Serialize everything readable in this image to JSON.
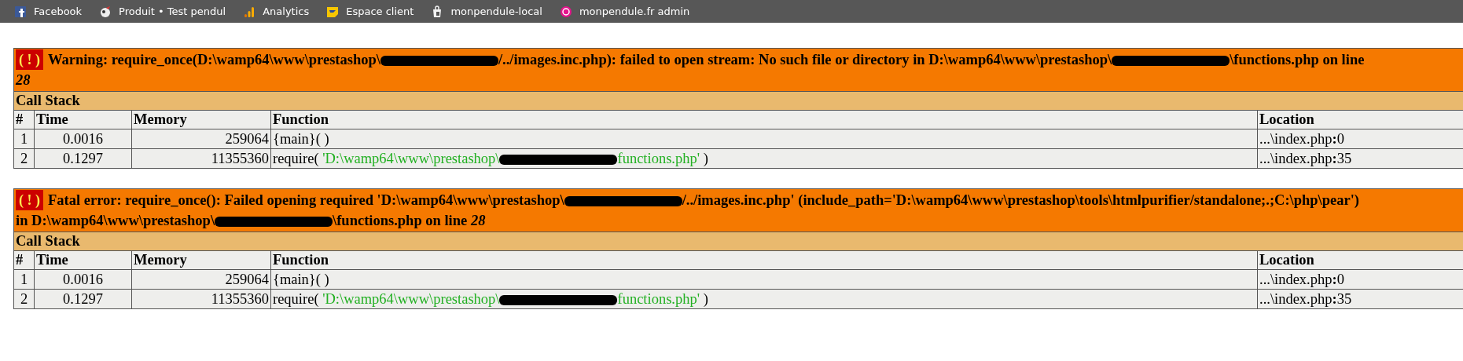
{
  "bookmarks": [
    {
      "label": "Facebook"
    },
    {
      "label": "Produit • Test pendul"
    },
    {
      "label": "Analytics"
    },
    {
      "label": "Espace client"
    },
    {
      "label": "monpendule-local"
    },
    {
      "label": "monpendule.fr admin"
    }
  ],
  "errors": [
    {
      "symbol": "( ! )",
      "lines": [
        [
          {
            "kind": "text",
            "text": "Warning: require_once(D:\\wamp64\\www\\prestashop\\"
          },
          {
            "kind": "redacted"
          },
          {
            "kind": "text",
            "text": "/../images.inc.php): failed to open stream: No such file or directory in D:\\wamp64\\www\\prestashop\\"
          },
          {
            "kind": "redacted"
          },
          {
            "kind": "text",
            "text": "\\functions.php on line"
          }
        ],
        [
          {
            "kind": "text",
            "text": "*28*"
          }
        ]
      ],
      "call_stack": {
        "title": "Call Stack",
        "columns": [
          "#",
          "Time",
          "Memory",
          "Function",
          "Location"
        ],
        "rows": [
          {
            "number": "1",
            "time": "0.0016",
            "memory": "259064",
            "function": [
              {
                "kind": "text",
                "text": "{main}( )"
              }
            ],
            "location": "...\\index.php**:**0"
          },
          {
            "number": "2",
            "time": "0.1297",
            "memory": "11355360",
            "function": [
              {
                "kind": "text",
                "text": "require( "
              },
              {
                "kind": "string",
                "text": "'D:\\wamp64\\www\\prestashop\\"
              },
              {
                "kind": "redacted"
              },
              {
                "kind": "string",
                "text": "functions.php'"
              },
              {
                "kind": "text",
                "text": " )"
              }
            ],
            "location": "...\\index.php**:**35"
          }
        ]
      }
    },
    {
      "symbol": "( ! )",
      "lines": [
        [
          {
            "kind": "text",
            "text": "Fatal error: require_once(): Failed opening required 'D:\\wamp64\\www\\prestashop\\"
          },
          {
            "kind": "redacted"
          },
          {
            "kind": "text",
            "text": "/../images.inc.php' (include_path='D:\\wamp64\\www\\prestashop\\tools\\htmlpurifier/standalone;.;C:\\php\\pear')"
          }
        ],
        [
          {
            "kind": "text",
            "text": "in D:\\wamp64\\www\\prestashop\\"
          },
          {
            "kind": "redacted"
          },
          {
            "kind": "text",
            "text": "\\functions.php on line *28*"
          }
        ]
      ],
      "call_stack": {
        "title": "Call Stack",
        "columns": [
          "#",
          "Time",
          "Memory",
          "Function",
          "Location"
        ],
        "rows": [
          {
            "number": "1",
            "time": "0.0016",
            "memory": "259064",
            "function": [
              {
                "kind": "text",
                "text": "{main}( )"
              }
            ],
            "location": "...\\index.php**:**0"
          },
          {
            "number": "2",
            "time": "0.1297",
            "memory": "11355360",
            "function": [
              {
                "kind": "text",
                "text": "require( "
              },
              {
                "kind": "string",
                "text": "'D:\\wamp64\\www\\prestashop\\"
              },
              {
                "kind": "redacted"
              },
              {
                "kind": "string",
                "text": "functions.php'"
              },
              {
                "kind": "text",
                "text": " )"
              }
            ],
            "location": "...\\index.php**:**35"
          }
        ]
      }
    }
  ]
}
